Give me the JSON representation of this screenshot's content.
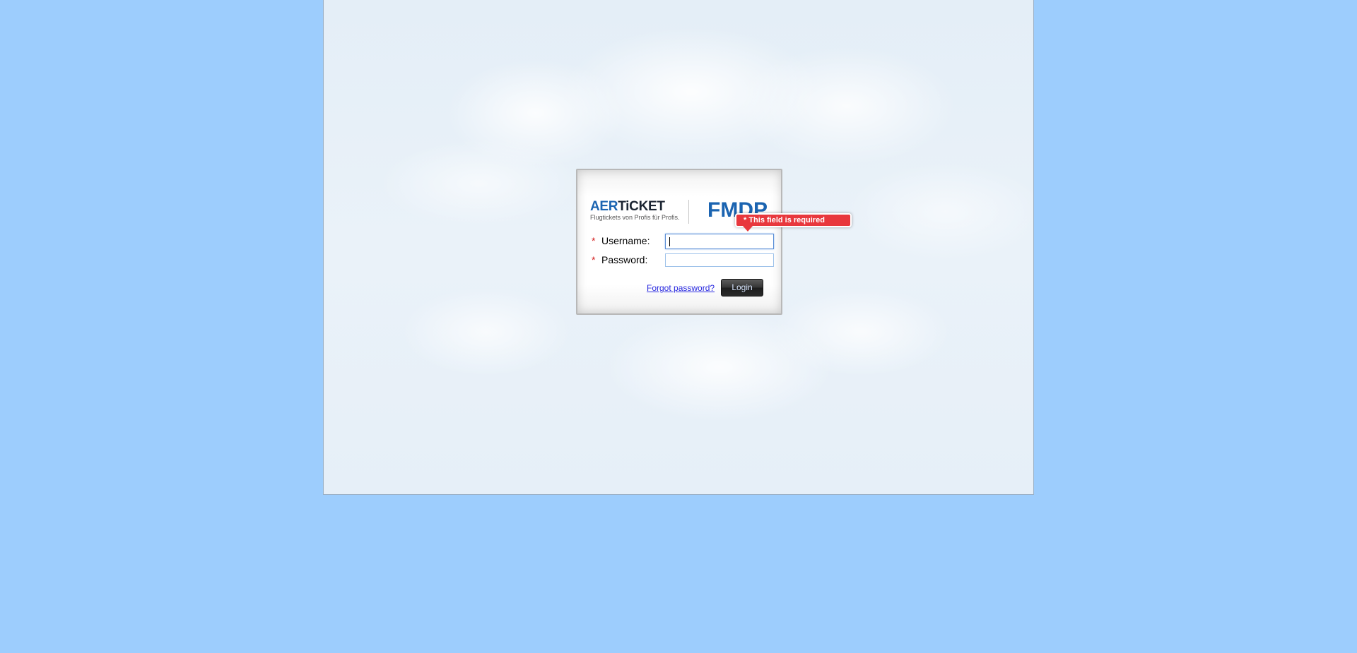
{
  "colors": {
    "background": "#9dcdfd",
    "brand_blue": "#1b64b1",
    "error_red": "#e8383d",
    "required_star": "#d32020",
    "link": "#2a2ae0"
  },
  "logo": {
    "aer_prefix": "AER",
    "aer_suffix": "TiCKET",
    "tagline": "Flugtickets von Profis für Profis.",
    "product": "FMDP"
  },
  "form": {
    "required_mark": "*",
    "username": {
      "label": "Username:",
      "value": ""
    },
    "password": {
      "label": "Password:",
      "value": ""
    },
    "forgot_password_label": "Forgot password?",
    "login_label": "Login"
  },
  "validation": {
    "message": "* This field is required"
  }
}
